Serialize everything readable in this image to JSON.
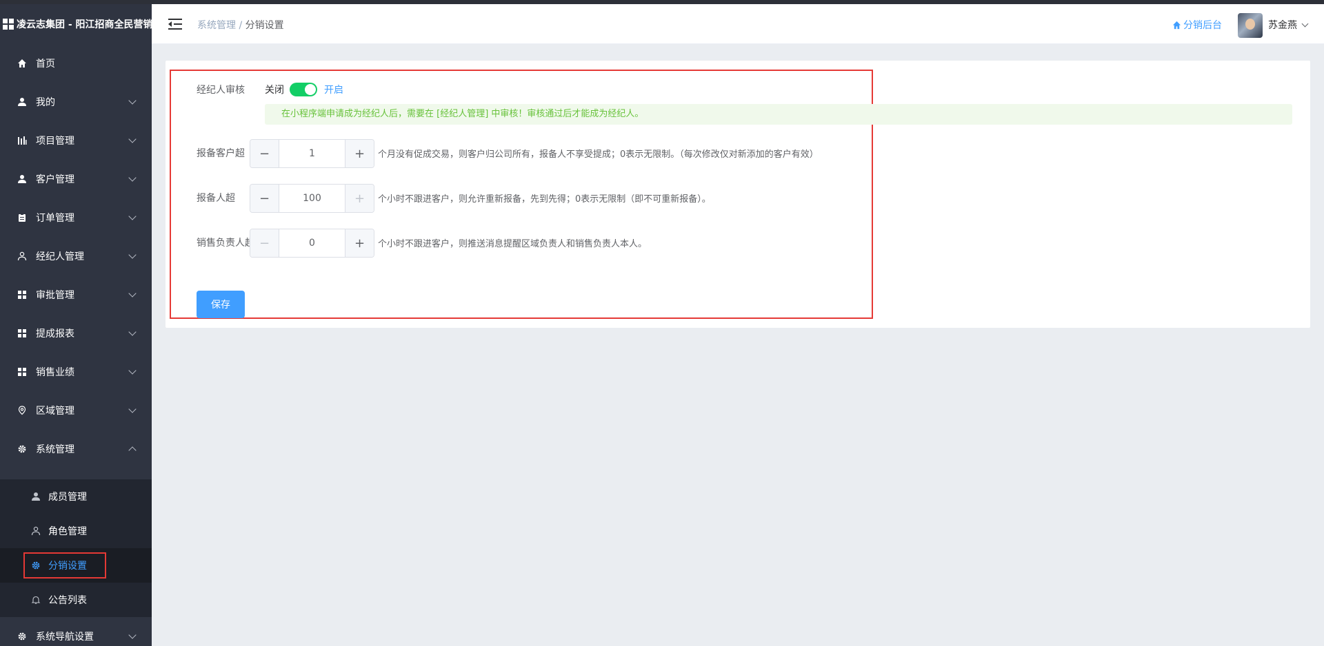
{
  "app": {
    "title": "凌云志集团 - 阳江招商全民营销"
  },
  "sidebar": {
    "items": [
      {
        "label": "首页",
        "icon": "home-icon"
      },
      {
        "label": "我的",
        "icon": "user-icon"
      },
      {
        "label": "项目管理",
        "icon": "chart-icon"
      },
      {
        "label": "客户管理",
        "icon": "user-icon"
      },
      {
        "label": "订单管理",
        "icon": "clipboard-icon"
      },
      {
        "label": "经纪人管理",
        "icon": "user-outline-icon"
      },
      {
        "label": "审批管理",
        "icon": "grid-icon"
      },
      {
        "label": "提成报表",
        "icon": "grid-icon"
      },
      {
        "label": "销售业绩",
        "icon": "grid-icon"
      },
      {
        "label": "区域管理",
        "icon": "location-icon"
      },
      {
        "label": "系统管理",
        "icon": "gear-icon"
      }
    ],
    "system_sub": [
      {
        "label": "成员管理",
        "icon": "user-icon"
      },
      {
        "label": "角色管理",
        "icon": "user-outline-icon"
      },
      {
        "label": "分销设置",
        "icon": "gear-icon"
      },
      {
        "label": "公告列表",
        "icon": "bell-icon"
      }
    ],
    "last_item": {
      "label": "系统导航设置",
      "icon": "gear-icon"
    }
  },
  "header": {
    "breadcrumb_parent": "系统管理",
    "breadcrumb_sep": " / ",
    "breadcrumb_current": "分销设置",
    "link_label": "分销后台",
    "username": "苏金燕"
  },
  "form": {
    "audit": {
      "label": "经纪人审核",
      "off_label": "关闭",
      "on_label": "开启",
      "enabled": true,
      "tip": "在小程序端申请成为经纪人后，需要在 [经纪人管理] 中审核！审核通过后才能成为经纪人。"
    },
    "customer": {
      "label": "报备客户超",
      "value": "1",
      "desc": "个月没有促成交易，则客户归公司所有，报备人不享受提成；0表示无限制。（每次修改仅对新添加的客户有效）"
    },
    "reporter": {
      "label": "报备人超",
      "value": "100",
      "desc": "个小时不跟进客户，则允许重新报备，先到先得；0表示无限制（即不可重新报备）。"
    },
    "sales": {
      "label": "销售负责人超",
      "value": "0",
      "desc": "个小时不跟进客户，则推送消息提醒区域负责人和销售负责人本人。"
    },
    "save_label": "保存"
  },
  "stepper": {
    "minus": "−",
    "plus": "+"
  },
  "colors": {
    "accent": "#409eff",
    "switch_on": "#13ce66",
    "highlight": "#e53935",
    "sidebar": "#2f3441"
  }
}
